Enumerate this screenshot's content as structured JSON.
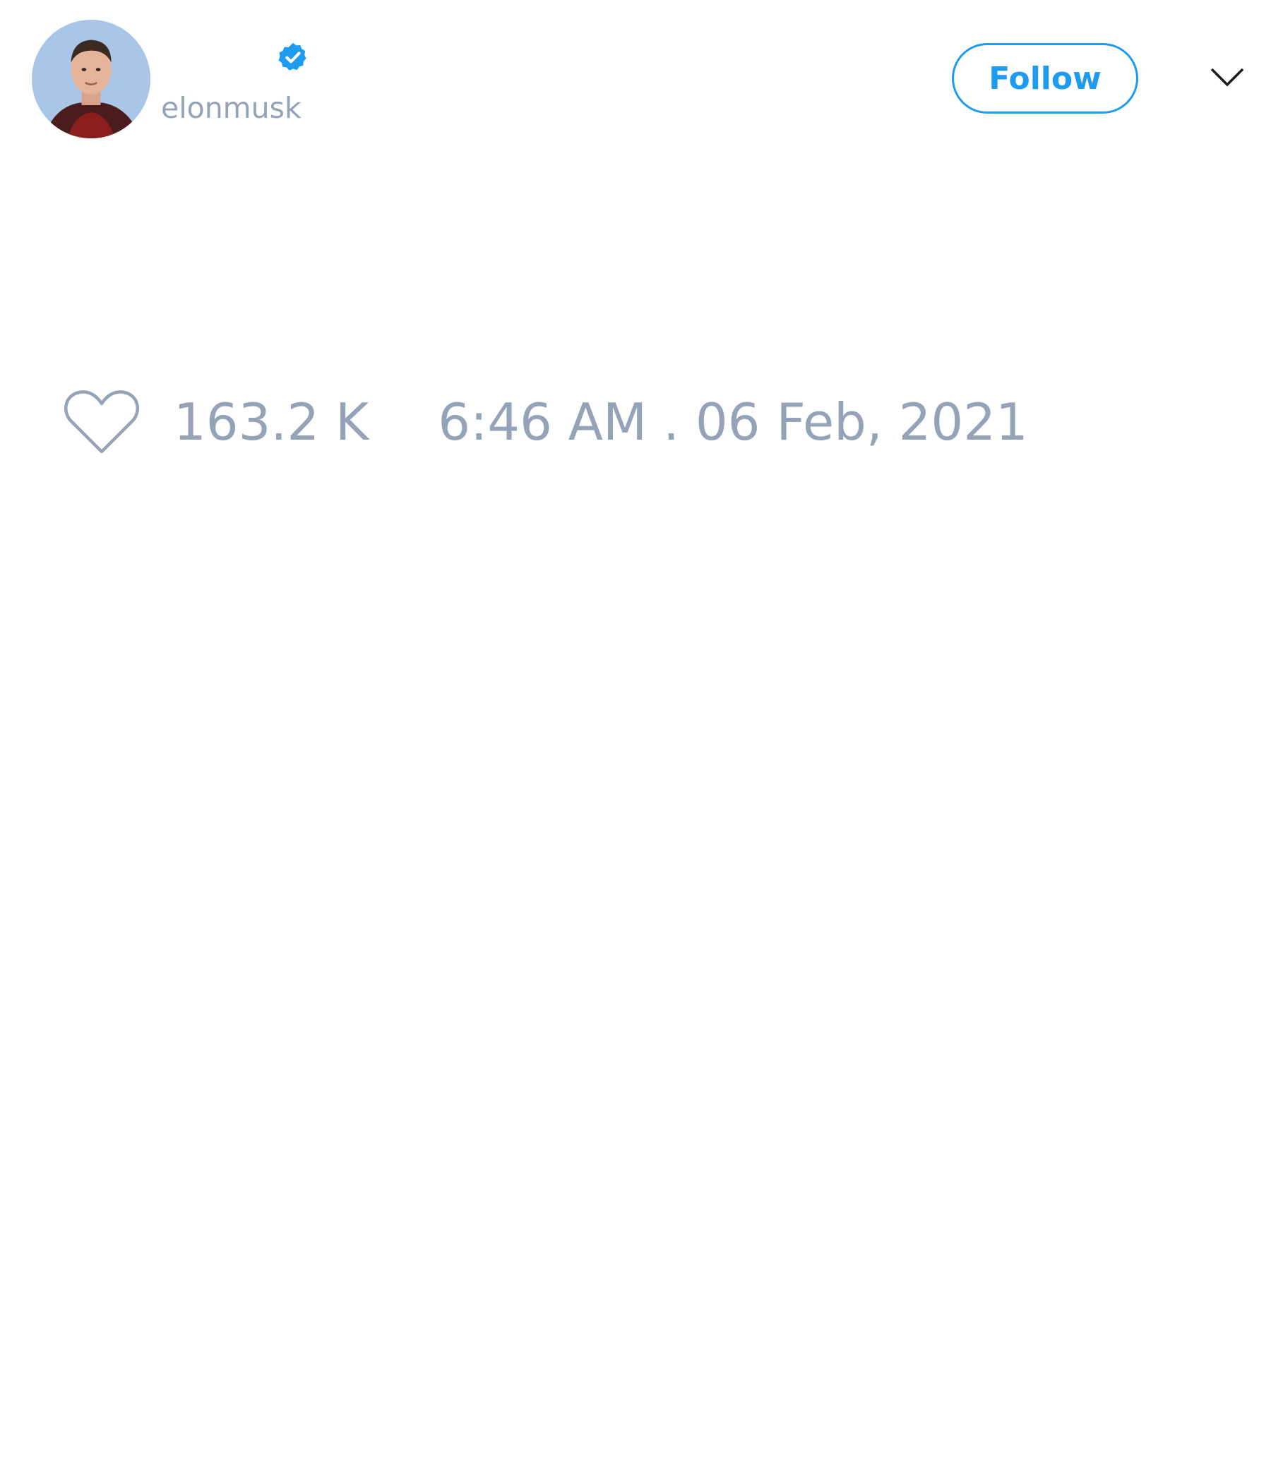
{
  "tweet": {
    "author": {
      "handle": "elonmusk",
      "verified": true
    },
    "follow_label": "Follow",
    "likes": "163.2 K",
    "timestamp": "6:46 AM . 06 Feb, 2021"
  },
  "icons": {
    "verified": "verified-badge-icon",
    "menu": "chevron-down-icon",
    "like": "heart-icon"
  },
  "colors": {
    "accent": "#1d9bf0",
    "muted_text": "#94a3b8",
    "background": "#ffffff"
  }
}
